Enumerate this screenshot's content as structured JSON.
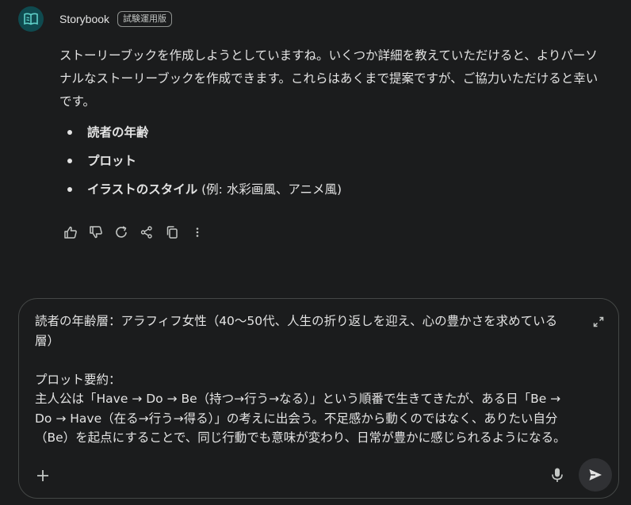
{
  "header": {
    "bot_name": "Storybook",
    "badge": "試験運用版"
  },
  "message": {
    "intro": "ストーリーブックを作成しようとしていますね。いくつか詳細を教えていただけると、よりパーソナルなストーリーブックを作成できます。これらはあくまで提案ですが、ご協力いただけると幸いです。",
    "bullets": [
      {
        "bold": "読者の年齢",
        "rest": ""
      },
      {
        "bold": "プロット",
        "rest": ""
      },
      {
        "bold": "イラストのスタイル",
        "rest": " (例: 水彩画風、アニメ風)"
      }
    ]
  },
  "actions": [
    "thumb-up-icon",
    "thumb-down-icon",
    "regenerate-icon",
    "share-icon",
    "copy-icon",
    "more-icon"
  ],
  "composer": {
    "text": "読者の年齢層：アラフィフ女性（40〜50代、人生の折り返しを迎え、心の豊かさを求めている\n層）\n\nプロット要約：\n主人公は「Have → Do → Be（持つ→行う→なる）」という順番で生きてきたが、ある日「Be →\nDo → Have（在る→行う→得る）」の考えに出会う。不足感から動くのではなく、ありたい自分\n（Be）を起点にすることで、同じ行動でも意味が変わり、日常が豊かに感じられるようになる。"
  },
  "colors": {
    "background": "#1b1c1d",
    "text": "#e3e3e3",
    "avatar": "#0f4a4f",
    "avatar_icon": "#5fd0c8"
  }
}
